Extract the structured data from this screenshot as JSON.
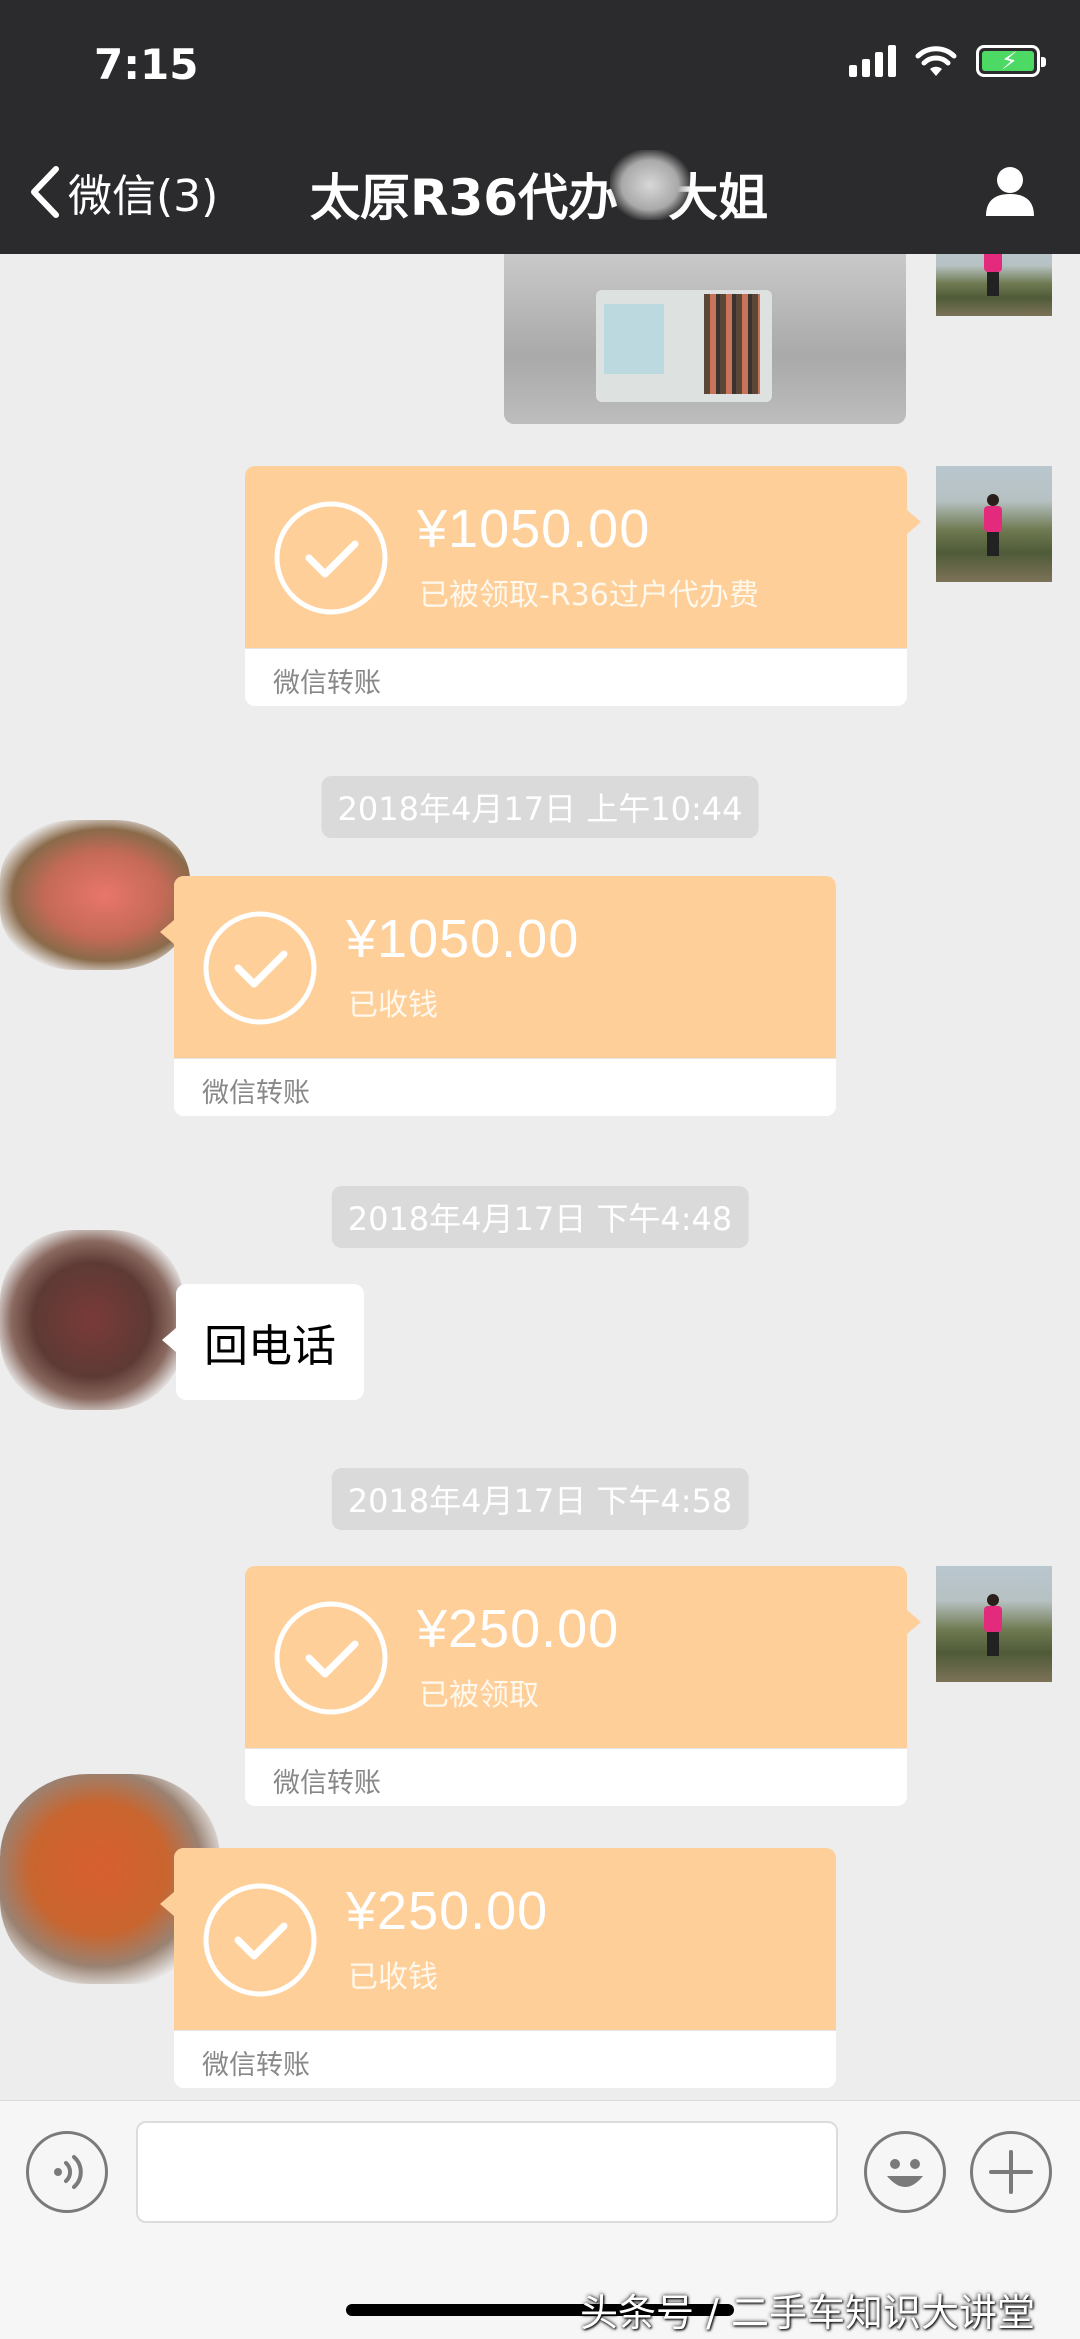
{
  "status_bar": {
    "time": "7:15"
  },
  "header": {
    "back_label": "微信(3)",
    "title": "太原R36代办　大姐"
  },
  "messages": {
    "transfer_1": {
      "amount": "¥1050.00",
      "status": "已被领取-R36过户代办费",
      "label": "微信转账"
    },
    "time_1": "2018年4月17日 上午10:44",
    "transfer_2": {
      "amount": "¥1050.00",
      "status": "已收钱",
      "label": "微信转账"
    },
    "time_2": "2018年4月17日 下午4:48",
    "text_1": "回电话",
    "time_3": "2018年4月17日 下午4:58",
    "transfer_3": {
      "amount": "¥250.00",
      "status": "已被领取",
      "label": "微信转账"
    },
    "transfer_4": {
      "amount": "¥250.00",
      "status": "已收钱",
      "label": "微信转账"
    }
  },
  "watermark": "头条号 / 二手车知识大讲堂",
  "colors": {
    "header_bg": "#2b2b2d",
    "chat_bg": "#ededed",
    "transfer_orange": "#fecf99",
    "battery_green": "#4cd964"
  },
  "icons": [
    "back-chevron-icon",
    "profile-icon",
    "check-circle-icon",
    "voice-icon",
    "emoji-icon",
    "plus-icon",
    "wifi-icon",
    "signal-icon",
    "battery-icon"
  ]
}
